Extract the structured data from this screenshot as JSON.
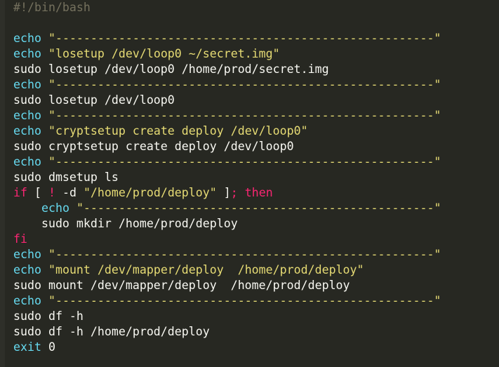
{
  "editor": {
    "colors": {
      "background": "#272822",
      "text": "#f8f8f2",
      "comment": "#75715e",
      "builtin": "#66d9ef",
      "string": "#e6db74",
      "keyword": "#f92672"
    },
    "lines": [
      [
        {
          "t": "#!/bin/bash",
          "c": "comment"
        }
      ],
      [],
      [
        {
          "t": "echo",
          "c": "builtin"
        },
        {
          "t": " ",
          "c": "plain"
        },
        {
          "t": "\"------------------------------------------------------\"",
          "c": "string"
        }
      ],
      [
        {
          "t": "echo",
          "c": "builtin"
        },
        {
          "t": " ",
          "c": "plain"
        },
        {
          "t": "\"losetup /dev/loop0 ~/secret.img\"",
          "c": "string"
        }
      ],
      [
        {
          "t": "sudo losetup /dev/loop0 /home/prod/secret.img",
          "c": "plain"
        }
      ],
      [
        {
          "t": "echo",
          "c": "builtin"
        },
        {
          "t": " ",
          "c": "plain"
        },
        {
          "t": "\"------------------------------------------------------\"",
          "c": "string"
        }
      ],
      [
        {
          "t": "sudo losetup /dev/loop0",
          "c": "plain"
        }
      ],
      [
        {
          "t": "echo",
          "c": "builtin"
        },
        {
          "t": " ",
          "c": "plain"
        },
        {
          "t": "\"------------------------------------------------------\"",
          "c": "string"
        }
      ],
      [
        {
          "t": "echo",
          "c": "builtin"
        },
        {
          "t": " ",
          "c": "plain"
        },
        {
          "t": "\"cryptsetup create deploy /dev/loop0\"",
          "c": "string"
        }
      ],
      [
        {
          "t": "sudo cryptsetup create deploy /dev/loop0",
          "c": "plain"
        }
      ],
      [
        {
          "t": "echo",
          "c": "builtin"
        },
        {
          "t": " ",
          "c": "plain"
        },
        {
          "t": "\"------------------------------------------------------\"",
          "c": "string"
        }
      ],
      [
        {
          "t": "sudo dmsetup ls",
          "c": "plain"
        }
      ],
      [
        {
          "t": "if",
          "c": "keyword"
        },
        {
          "t": " [ ",
          "c": "plain"
        },
        {
          "t": "!",
          "c": "keyword"
        },
        {
          "t": " -d ",
          "c": "plain"
        },
        {
          "t": "\"/home/prod/deploy\"",
          "c": "string"
        },
        {
          "t": " ]",
          "c": "plain"
        },
        {
          "t": "; then",
          "c": "keyword"
        }
      ],
      [
        {
          "t": "    ",
          "c": "plain"
        },
        {
          "t": "echo",
          "c": "builtin"
        },
        {
          "t": " ",
          "c": "plain"
        },
        {
          "t": "\"--------------------------------------------------\"",
          "c": "string"
        }
      ],
      [
        {
          "t": "    sudo mkdir /home/prod/deploy",
          "c": "plain"
        }
      ],
      [
        {
          "t": "fi",
          "c": "keyword"
        }
      ],
      [
        {
          "t": "echo",
          "c": "builtin"
        },
        {
          "t": " ",
          "c": "plain"
        },
        {
          "t": "\"------------------------------------------------------\"",
          "c": "string"
        }
      ],
      [
        {
          "t": "echo",
          "c": "builtin"
        },
        {
          "t": " ",
          "c": "plain"
        },
        {
          "t": "\"mount /dev/mapper/deploy  /home/prod/deploy\"",
          "c": "string"
        }
      ],
      [
        {
          "t": "sudo mount /dev/mapper/deploy  /home/prod/deploy",
          "c": "plain"
        }
      ],
      [
        {
          "t": "echo",
          "c": "builtin"
        },
        {
          "t": " ",
          "c": "plain"
        },
        {
          "t": "\"------------------------------------------------------\"",
          "c": "string"
        }
      ],
      [
        {
          "t": "sudo df -h",
          "c": "plain"
        }
      ],
      [
        {
          "t": "sudo df -h /home/prod/deploy",
          "c": "plain"
        }
      ],
      [
        {
          "t": "exit 0",
          "c": "builtin"
        }
      ]
    ]
  }
}
